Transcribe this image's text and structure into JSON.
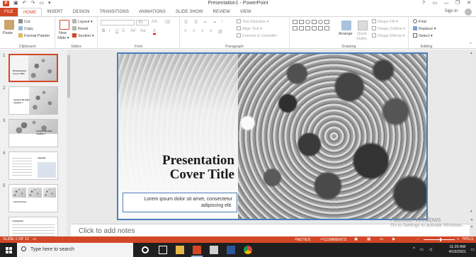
{
  "window": {
    "title": "Presentation1 - PowerPoint",
    "help": "?",
    "signin": "Sign in"
  },
  "tabs": [
    "FILE",
    "HOME",
    "INSERT",
    "DESIGN",
    "TRANSITIONS",
    "ANIMATIONS",
    "SLIDE SHOW",
    "REVIEW",
    "VIEW"
  ],
  "ribbon": {
    "clipboard": {
      "paste": "Paste",
      "cut": "Cut",
      "copy": "Copy",
      "format_painter": "Format Painter",
      "label": "Clipboard"
    },
    "slides": {
      "new_slide": "New",
      "new_slide2": "Slide",
      "layout": "Layout",
      "reset": "Reset",
      "section": "Section",
      "label": "Slides"
    },
    "font": {
      "size": "45",
      "label": "Font",
      "bold": "B",
      "italic": "I",
      "underline": "U",
      "strike": "S",
      "aa": "AA",
      "aa_small": "Aa",
      "font_color": "A"
    },
    "paragraph": {
      "text_direction": "Text Direction",
      "align_text": "Align Text",
      "convert": "Convert to SmartArt",
      "label": "Paragraph"
    },
    "drawing": {
      "arrange": "Arrange",
      "quick_styles": "Quick",
      "quick_styles2": "Styles",
      "shape_fill": "Shape Fill",
      "shape_outline": "Shape Outline",
      "shape_effects": "Shape Effects",
      "label": "Drawing"
    },
    "editing": {
      "find": "Find",
      "replace": "Replace",
      "select": "Select",
      "label": "Editing"
    }
  },
  "thumbnails": [
    {
      "num": "1",
      "title": "Presentation Cover Title"
    },
    {
      "num": "2",
      "title": "Section Divider Option 1"
    },
    {
      "num": "3",
      "title": "Section Divider Option 2"
    },
    {
      "num": "4",
      "title": "Agenda"
    },
    {
      "num": "5",
      "title": "Our Process"
    },
    {
      "num": "6",
      "title": "Categories"
    }
  ],
  "slide": {
    "title_line1": "Presentation",
    "title_line2": "Cover Title",
    "subtitle": "Lorem ipsum dolor sit amet, consectetur adipiscing elit."
  },
  "notes_placeholder": "Click to add notes",
  "activation": {
    "line1": "Activate Windows",
    "line2": "Go to Settings to activate Windows."
  },
  "statusbar": {
    "slide_indicator": "SLIDE 1 OF 11",
    "notes": "NOTES",
    "comments": "COMMENTS",
    "zoom": "70%",
    "zoom_level_fraction": 0.55
  },
  "taskbar": {
    "search_placeholder": "Type here to search",
    "time": "11:20 AM",
    "date": "4/19/2021"
  },
  "colors": {
    "accent": "#d24726",
    "selection": "#4a7ebb"
  }
}
